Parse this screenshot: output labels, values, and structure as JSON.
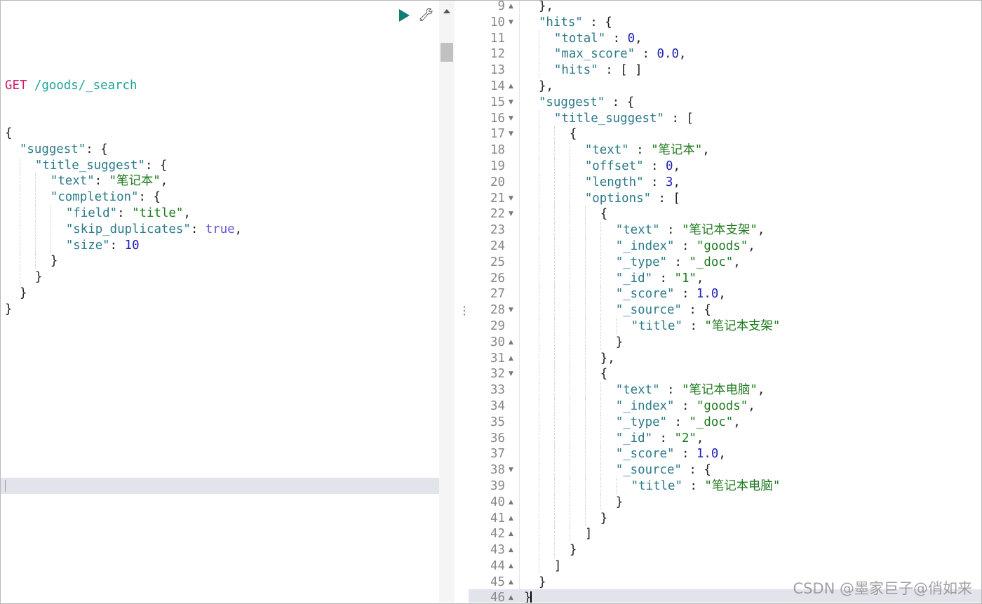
{
  "toolbar": {
    "run_icon": "play-icon",
    "settings_icon": "wrench-icon"
  },
  "request": {
    "method": "GET",
    "path": "/goods/_search",
    "lines": [
      {
        "i": 0,
        "t": [
          [
            "p",
            "{"
          ]
        ]
      },
      {
        "i": 1,
        "t": [
          [
            "k",
            "\"suggest\""
          ],
          [
            "p",
            ": {"
          ]
        ]
      },
      {
        "i": 2,
        "t": [
          [
            "k",
            "\"title_suggest\""
          ],
          [
            "p",
            ": {"
          ]
        ]
      },
      {
        "i": 3,
        "t": [
          [
            "k",
            "\"text\""
          ],
          [
            "p",
            ": "
          ],
          [
            "s",
            "\"笔记本\""
          ],
          [
            "p",
            ","
          ]
        ]
      },
      {
        "i": 3,
        "t": [
          [
            "k",
            "\"completion\""
          ],
          [
            "p",
            ": {"
          ]
        ]
      },
      {
        "i": 4,
        "t": [
          [
            "k",
            "\"field\""
          ],
          [
            "p",
            ": "
          ],
          [
            "s",
            "\"title\""
          ],
          [
            "p",
            ","
          ]
        ]
      },
      {
        "i": 4,
        "t": [
          [
            "k",
            "\"skip_duplicates\""
          ],
          [
            "p",
            ": "
          ],
          [
            "b",
            "true"
          ],
          [
            "p",
            ","
          ]
        ]
      },
      {
        "i": 4,
        "t": [
          [
            "k",
            "\"size\""
          ],
          [
            "p",
            ": "
          ],
          [
            "n",
            "10"
          ]
        ]
      },
      {
        "i": 3,
        "t": [
          [
            "p",
            "}"
          ]
        ]
      },
      {
        "i": 2,
        "t": [
          [
            "p",
            "}"
          ]
        ]
      },
      {
        "i": 1,
        "t": [
          [
            "p",
            "}"
          ]
        ]
      },
      {
        "i": 0,
        "t": [
          [
            "p",
            "}"
          ]
        ]
      }
    ]
  },
  "response": {
    "lines": [
      {
        "n": "9",
        "f": "up",
        "i": 1,
        "t": [
          [
            "p",
            "},"
          ]
        ]
      },
      {
        "n": "10",
        "f": "down",
        "i": 1,
        "t": [
          [
            "k",
            "\"hits\""
          ],
          [
            "p",
            " : {"
          ]
        ]
      },
      {
        "n": "11",
        "i": 2,
        "t": [
          [
            "k",
            "\"total\""
          ],
          [
            "p",
            " : "
          ],
          [
            "n",
            "0"
          ],
          [
            "p",
            ","
          ]
        ]
      },
      {
        "n": "12",
        "i": 2,
        "t": [
          [
            "k",
            "\"max_score\""
          ],
          [
            "p",
            " : "
          ],
          [
            "n",
            "0.0"
          ],
          [
            "p",
            ","
          ]
        ]
      },
      {
        "n": "13",
        "i": 2,
        "t": [
          [
            "k",
            "\"hits\""
          ],
          [
            "p",
            " : [ ]"
          ]
        ]
      },
      {
        "n": "14",
        "f": "up",
        "i": 1,
        "t": [
          [
            "p",
            "},"
          ]
        ]
      },
      {
        "n": "15",
        "f": "down",
        "i": 1,
        "t": [
          [
            "k",
            "\"suggest\""
          ],
          [
            "p",
            " : {"
          ]
        ]
      },
      {
        "n": "16",
        "f": "down",
        "i": 2,
        "t": [
          [
            "k",
            "\"title_suggest\""
          ],
          [
            "p",
            " : ["
          ]
        ]
      },
      {
        "n": "17",
        "f": "down",
        "i": 3,
        "t": [
          [
            "p",
            "{"
          ]
        ]
      },
      {
        "n": "18",
        "i": 4,
        "t": [
          [
            "k",
            "\"text\""
          ],
          [
            "p",
            " : "
          ],
          [
            "s",
            "\"笔记本\""
          ],
          [
            "p",
            ","
          ]
        ]
      },
      {
        "n": "19",
        "i": 4,
        "t": [
          [
            "k",
            "\"offset\""
          ],
          [
            "p",
            " : "
          ],
          [
            "n",
            "0"
          ],
          [
            "p",
            ","
          ]
        ]
      },
      {
        "n": "20",
        "i": 4,
        "t": [
          [
            "k",
            "\"length\""
          ],
          [
            "p",
            " : "
          ],
          [
            "n",
            "3"
          ],
          [
            "p",
            ","
          ]
        ]
      },
      {
        "n": "21",
        "f": "down",
        "i": 4,
        "t": [
          [
            "k",
            "\"options\""
          ],
          [
            "p",
            " : ["
          ]
        ]
      },
      {
        "n": "22",
        "f": "down",
        "i": 5,
        "t": [
          [
            "p",
            "{"
          ]
        ]
      },
      {
        "n": "23",
        "i": 6,
        "t": [
          [
            "k",
            "\"text\""
          ],
          [
            "p",
            " : "
          ],
          [
            "s",
            "\"笔记本支架\""
          ],
          [
            "p",
            ","
          ]
        ]
      },
      {
        "n": "24",
        "i": 6,
        "t": [
          [
            "k",
            "\"_index\""
          ],
          [
            "p",
            " : "
          ],
          [
            "s",
            "\"goods\""
          ],
          [
            "p",
            ","
          ]
        ]
      },
      {
        "n": "25",
        "i": 6,
        "t": [
          [
            "k",
            "\"_type\""
          ],
          [
            "p",
            " : "
          ],
          [
            "s",
            "\"_doc\""
          ],
          [
            "p",
            ","
          ]
        ]
      },
      {
        "n": "26",
        "i": 6,
        "t": [
          [
            "k",
            "\"_id\""
          ],
          [
            "p",
            " : "
          ],
          [
            "s",
            "\"1\""
          ],
          [
            "p",
            ","
          ]
        ]
      },
      {
        "n": "27",
        "i": 6,
        "t": [
          [
            "k",
            "\"_score\""
          ],
          [
            "p",
            " : "
          ],
          [
            "n",
            "1.0"
          ],
          [
            "p",
            ","
          ]
        ]
      },
      {
        "n": "28",
        "f": "down",
        "i": 6,
        "t": [
          [
            "k",
            "\"_source\""
          ],
          [
            "p",
            " : {"
          ]
        ]
      },
      {
        "n": "29",
        "i": 7,
        "t": [
          [
            "k",
            "\"title\""
          ],
          [
            "p",
            " : "
          ],
          [
            "s",
            "\"笔记本支架\""
          ]
        ]
      },
      {
        "n": "30",
        "f": "up",
        "i": 6,
        "t": [
          [
            "p",
            "}"
          ]
        ]
      },
      {
        "n": "31",
        "f": "up",
        "i": 5,
        "t": [
          [
            "p",
            "},"
          ]
        ]
      },
      {
        "n": "32",
        "f": "down",
        "i": 5,
        "t": [
          [
            "p",
            "{"
          ]
        ]
      },
      {
        "n": "33",
        "i": 6,
        "t": [
          [
            "k",
            "\"text\""
          ],
          [
            "p",
            " : "
          ],
          [
            "s",
            "\"笔记本电脑\""
          ],
          [
            "p",
            ","
          ]
        ]
      },
      {
        "n": "34",
        "i": 6,
        "t": [
          [
            "k",
            "\"_index\""
          ],
          [
            "p",
            " : "
          ],
          [
            "s",
            "\"goods\""
          ],
          [
            "p",
            ","
          ]
        ]
      },
      {
        "n": "35",
        "i": 6,
        "t": [
          [
            "k",
            "\"_type\""
          ],
          [
            "p",
            " : "
          ],
          [
            "s",
            "\"_doc\""
          ],
          [
            "p",
            ","
          ]
        ]
      },
      {
        "n": "36",
        "i": 6,
        "t": [
          [
            "k",
            "\"_id\""
          ],
          [
            "p",
            " : "
          ],
          [
            "s",
            "\"2\""
          ],
          [
            "p",
            ","
          ]
        ]
      },
      {
        "n": "37",
        "i": 6,
        "t": [
          [
            "k",
            "\"_score\""
          ],
          [
            "p",
            " : "
          ],
          [
            "n",
            "1.0"
          ],
          [
            "p",
            ","
          ]
        ]
      },
      {
        "n": "38",
        "f": "down",
        "i": 6,
        "t": [
          [
            "k",
            "\"_source\""
          ],
          [
            "p",
            " : {"
          ]
        ]
      },
      {
        "n": "39",
        "i": 7,
        "t": [
          [
            "k",
            "\"title\""
          ],
          [
            "p",
            " : "
          ],
          [
            "s",
            "\"笔记本电脑\""
          ]
        ]
      },
      {
        "n": "40",
        "f": "up",
        "i": 6,
        "t": [
          [
            "p",
            "}"
          ]
        ]
      },
      {
        "n": "41",
        "f": "up",
        "i": 5,
        "t": [
          [
            "p",
            "}"
          ]
        ]
      },
      {
        "n": "42",
        "f": "up",
        "i": 4,
        "t": [
          [
            "p",
            "]"
          ]
        ]
      },
      {
        "n": "43",
        "f": "up",
        "i": 3,
        "t": [
          [
            "p",
            "}"
          ]
        ]
      },
      {
        "n": "44",
        "f": "up",
        "i": 2,
        "t": [
          [
            "p",
            "]"
          ]
        ]
      },
      {
        "n": "45",
        "f": "up",
        "i": 1,
        "t": [
          [
            "p",
            "}"
          ]
        ]
      },
      {
        "n": "46",
        "f": "up",
        "i": 0,
        "t": [
          [
            "p",
            "}"
          ]
        ],
        "cursor": true
      }
    ]
  },
  "watermark": "CSDN @墨家巨子@俏如来"
}
